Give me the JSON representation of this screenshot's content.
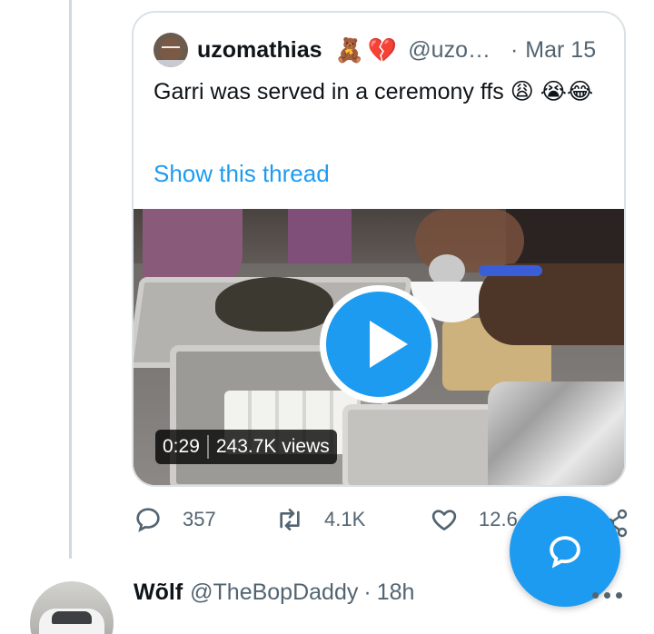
{
  "quoted_tweet": {
    "author_name": "uzomathias",
    "author_emojis": "🧸💔",
    "author_handle": "@uzo…",
    "date_separator": "·",
    "date": "Mar 15",
    "text": "Garri was served in a ceremony ffs 😩 😭😂",
    "show_thread_label": "Show this thread",
    "video": {
      "duration": "0:29",
      "views": "243.7K views",
      "play_icon": "play-icon"
    }
  },
  "actions": {
    "replies": "357",
    "retweets": "4.1K",
    "likes": "12.6",
    "reply_icon": "comment-icon",
    "retweet_icon": "retweet-icon",
    "like_icon": "heart-icon",
    "share_icon": "share-icon"
  },
  "compose_fab": {
    "icon": "compose-reply-icon"
  },
  "reply": {
    "author_name": "Wõlf",
    "author_handle": "@TheBopDaddy",
    "separator": "·",
    "time": "18h",
    "more_icon": "more-icon"
  },
  "colors": {
    "accent": "#1d9bf0",
    "muted_text": "#536471",
    "primary_text": "#0f1419",
    "border": "#d9e1e6"
  }
}
